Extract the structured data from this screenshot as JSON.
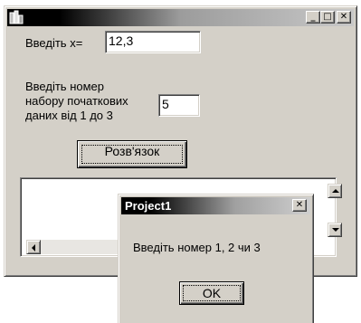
{
  "window": {
    "title_buttons": {
      "minimize": "_",
      "maximize": "□",
      "close": "✕"
    }
  },
  "form": {
    "x_label": "Введіть х=",
    "x_value": "12,3",
    "set_label": "Введіть номер\nнабору початкових\nданих від 1 до 3",
    "set_value": "5",
    "solve_button": "Розв'язок"
  },
  "dialog": {
    "title": "Project1",
    "close": "✕",
    "message": "Введіть номер 1, 2 чи 3",
    "ok_button": "OK"
  },
  "colors": {
    "face": "#d4d0c8",
    "shadow": "#808080",
    "dark_shadow": "#404040",
    "highlight": "#ffffff"
  },
  "icons": {
    "app": "delphi-app-icon",
    "scroll_up": "arrow-up-icon",
    "scroll_down": "arrow-down-icon",
    "scroll_left": "arrow-left-icon"
  }
}
